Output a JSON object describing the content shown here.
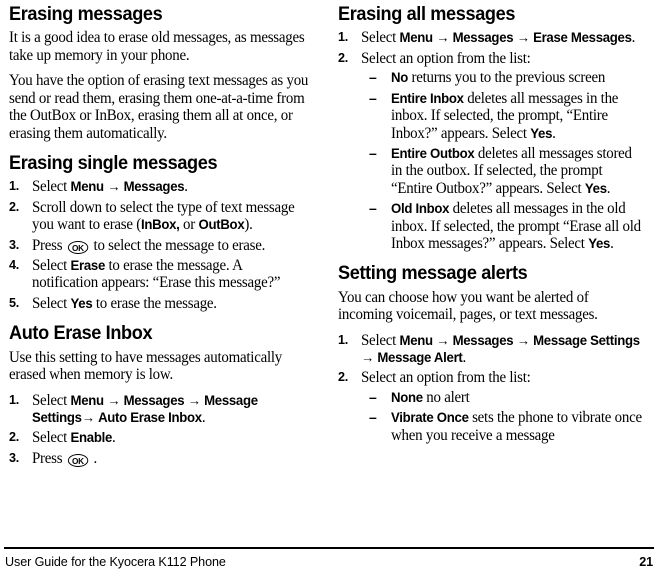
{
  "document": {
    "footer_text": "User Guide for the Kyocera K112 Phone",
    "page_number": "21"
  },
  "left_column": {
    "section1": {
      "heading": "Erasing messages",
      "paragraphs": [
        "It is a good idea to erase old messages, as messages take up memory in your phone.",
        "You have the option of erasing text messages as you send or read them, erasing them one-at-a-time from the OutBox or InBox, erasing them all at once, or erasing them automatically."
      ]
    },
    "section2": {
      "heading": "Erasing single messages",
      "steps": [
        {
          "num": "1.",
          "parts": [
            {
              "t": "text",
              "v": "Select "
            },
            {
              "t": "ui",
              "v": "Menu"
            },
            {
              "t": "arrow",
              "v": " → "
            },
            {
              "t": "ui",
              "v": "Messages"
            },
            {
              "t": "text",
              "v": "."
            }
          ]
        },
        {
          "num": "2.",
          "parts": [
            {
              "t": "text",
              "v": "Scroll down to select the type of text message you want to erase ("
            },
            {
              "t": "ui",
              "v": "InBox,"
            },
            {
              "t": "text",
              "v": " or "
            },
            {
              "t": "ui",
              "v": "OutBox"
            },
            {
              "t": "text",
              "v": ")."
            }
          ]
        },
        {
          "num": "3.",
          "parts": [
            {
              "t": "text",
              "v": "Press "
            },
            {
              "t": "okkey",
              "v": "OK"
            },
            {
              "t": "text",
              "v": " to select the message to erase."
            }
          ]
        },
        {
          "num": "4.",
          "parts": [
            {
              "t": "text",
              "v": "Select "
            },
            {
              "t": "ui",
              "v": "Erase"
            },
            {
              "t": "text",
              "v": " to erase the message. A notification appears: “Erase this message?”"
            }
          ]
        },
        {
          "num": "5.",
          "parts": [
            {
              "t": "text",
              "v": "Select "
            },
            {
              "t": "ui",
              "v": "Yes"
            },
            {
              "t": "text",
              "v": " to erase the message."
            }
          ]
        }
      ]
    },
    "section3": {
      "heading": "Auto Erase Inbox",
      "paragraphs": [
        "Use this setting to have messages automatically erased when memory is low."
      ],
      "steps": [
        {
          "num": "1.",
          "parts": [
            {
              "t": "text",
              "v": "Select "
            },
            {
              "t": "ui",
              "v": "Menu"
            },
            {
              "t": "arrow",
              "v": " → "
            },
            {
              "t": "ui",
              "v": "Messages"
            },
            {
              "t": "arrow",
              "v": " → "
            },
            {
              "t": "ui",
              "v": "Message Settings"
            },
            {
              "t": "arrow",
              "v": "→ "
            },
            {
              "t": "ui",
              "v": "Auto Erase Inbox"
            },
            {
              "t": "text",
              "v": "."
            }
          ]
        },
        {
          "num": "2.",
          "parts": [
            {
              "t": "text",
              "v": "Select "
            },
            {
              "t": "ui",
              "v": "Enable"
            },
            {
              "t": "text",
              "v": "."
            }
          ]
        },
        {
          "num": "3.",
          "parts": [
            {
              "t": "text",
              "v": "Press "
            },
            {
              "t": "okkey",
              "v": "OK"
            },
            {
              "t": "text",
              "v": " ."
            }
          ]
        }
      ]
    }
  },
  "right_column": {
    "section1": {
      "heading": "Erasing all messages",
      "steps": [
        {
          "num": "1.",
          "parts": [
            {
              "t": "text",
              "v": "Select "
            },
            {
              "t": "ui",
              "v": "Menu"
            },
            {
              "t": "arrow",
              "v": " → "
            },
            {
              "t": "ui",
              "v": "Messages"
            },
            {
              "t": "arrow",
              "v": " → "
            },
            {
              "t": "ui",
              "v": "Erase Messages"
            },
            {
              "t": "text",
              "v": "."
            }
          ]
        },
        {
          "num": "2.",
          "parts": [
            {
              "t": "text",
              "v": "Select an option from the list:"
            }
          ],
          "sublist": [
            {
              "dash": "–",
              "parts": [
                {
                  "t": "ui",
                  "v": "No"
                },
                {
                  "t": "text",
                  "v": " returns you to the previous screen"
                }
              ]
            },
            {
              "dash": "–",
              "parts": [
                {
                  "t": "ui",
                  "v": "Entire Inbox"
                },
                {
                  "t": "text",
                  "v": " deletes all messages in the inbox. If selected, the prompt, “Entire Inbox?” appears. Select "
                },
                {
                  "t": "ui",
                  "v": "Yes"
                },
                {
                  "t": "text",
                  "v": "."
                }
              ]
            },
            {
              "dash": "–",
              "parts": [
                {
                  "t": "ui",
                  "v": "Entire Outbox"
                },
                {
                  "t": "text",
                  "v": " deletes all messages stored in the outbox. If selected, the prompt “Entire Outbox?” appears. Select "
                },
                {
                  "t": "ui",
                  "v": "Yes"
                },
                {
                  "t": "text",
                  "v": "."
                }
              ]
            },
            {
              "dash": "–",
              "parts": [
                {
                  "t": "ui",
                  "v": "Old Inbox"
                },
                {
                  "t": "text",
                  "v": " deletes all messages in the old inbox. If selected, the prompt “Erase all old Inbox messages?” appears. Select "
                },
                {
                  "t": "ui",
                  "v": "Yes"
                },
                {
                  "t": "text",
                  "v": "."
                }
              ]
            }
          ]
        }
      ]
    },
    "section2": {
      "heading": "Setting message alerts",
      "paragraphs": [
        "You can choose how you want be alerted of incoming voicemail, pages, or text messages."
      ],
      "steps": [
        {
          "num": "1.",
          "parts": [
            {
              "t": "text",
              "v": "Select "
            },
            {
              "t": "ui",
              "v": "Menu"
            },
            {
              "t": "arrow",
              "v": " → "
            },
            {
              "t": "ui",
              "v": "Messages"
            },
            {
              "t": "arrow",
              "v": " → "
            },
            {
              "t": "ui",
              "v": "Message Settings"
            },
            {
              "t": "arrow",
              "v": " → "
            },
            {
              "t": "ui",
              "v": "Message Alert"
            },
            {
              "t": "text",
              "v": "."
            }
          ]
        },
        {
          "num": "2.",
          "parts": [
            {
              "t": "text",
              "v": "Select an option from the list:"
            }
          ],
          "sublist": [
            {
              "dash": "–",
              "parts": [
                {
                  "t": "ui",
                  "v": "None"
                },
                {
                  "t": "text",
                  "v": " no alert"
                }
              ]
            },
            {
              "dash": "–",
              "parts": [
                {
                  "t": "ui",
                  "v": "Vibrate Once"
                },
                {
                  "t": "text",
                  "v": " sets the phone to vibrate once when you receive a message"
                }
              ]
            }
          ]
        }
      ]
    }
  }
}
